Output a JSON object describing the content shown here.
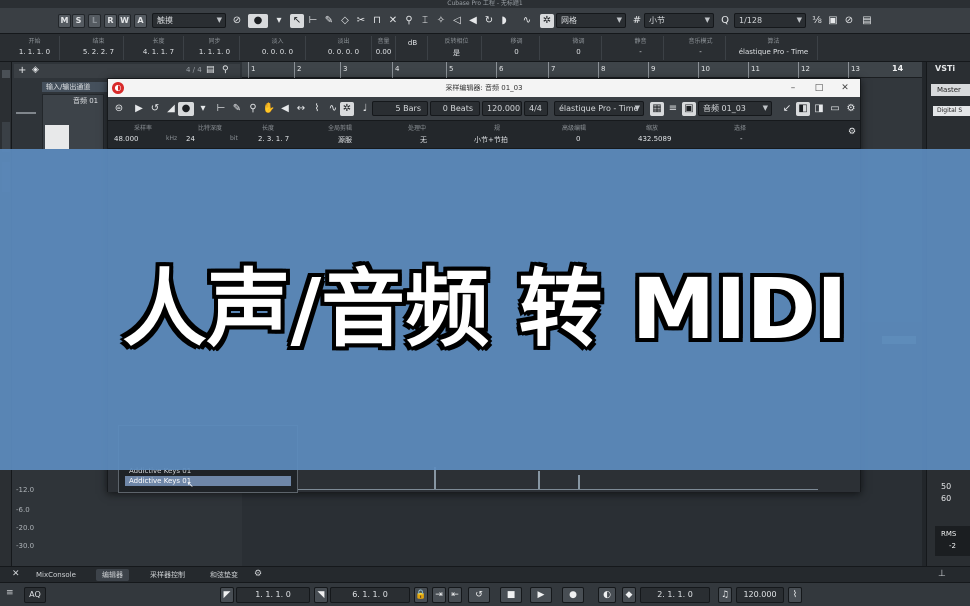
{
  "window": {
    "title": "Cubase Pro 工程 - 无标题1"
  },
  "toolbar": {
    "track_buttons": [
      "M",
      "S",
      "L",
      "R",
      "W",
      "A"
    ],
    "mode_select": "触摸",
    "snap_type": "网格",
    "grid_type": "小节",
    "quantize": "1/128"
  },
  "info_line": [
    {
      "label": "开始",
      "value": "1. 1. 1.   0"
    },
    {
      "label": "结束",
      "value": "5. 2. 2. 7"
    },
    {
      "label": "长度",
      "value": "4. 1. 1. 7"
    },
    {
      "label": "同步",
      "value": "1. 1. 1.   0"
    },
    {
      "label": "淡入",
      "value": "0. 0. 0.   0"
    },
    {
      "label": "淡出",
      "value": "0. 0. 0.   0"
    },
    {
      "label": "音量",
      "value": "0.00"
    },
    {
      "label": "",
      "value": "dB"
    },
    {
      "label": "反转相位",
      "value": "是"
    },
    {
      "label": "移调",
      "value": "0"
    },
    {
      "label": "微调",
      "value": "0"
    },
    {
      "label": "静音",
      "value": "-"
    },
    {
      "label": "音乐模式",
      "value": "-"
    },
    {
      "label": "算法",
      "value": "élastique Pro - Time"
    }
  ],
  "ruler": {
    "marks": [
      "1",
      "2",
      "3",
      "4",
      "5",
      "6",
      "7",
      "8",
      "9",
      "10",
      "11",
      "12",
      "13"
    ],
    "zoom_label": "14",
    "page": "4 / 4"
  },
  "tracklist": {
    "header": "输入/输出通道",
    "track": "音频 01"
  },
  "vsti": {
    "title": "VSTi",
    "master": "Master",
    "digital": "Digital S"
  },
  "editor": {
    "title": "采样编辑器: 音频 01_03",
    "toolbar": {
      "bars": "5 Bars",
      "beats": "0 Beats",
      "tempo": "120.000",
      "signature": "4/4",
      "algorithm": "élastique Pro - Time",
      "event": "音频 01_03"
    },
    "info": [
      {
        "label": "采样率",
        "value": "48.000",
        "unit": "kHz"
      },
      {
        "label": "比特深度",
        "value": "24",
        "unit": "bit"
      },
      {
        "label": "长度",
        "value": "2. 3. 1. 7",
        "unit": ""
      },
      {
        "label": "全局剪辑",
        "value": "源服",
        "unit": ""
      },
      {
        "label": "处理中",
        "value": "无",
        "unit": ""
      },
      {
        "label": "规",
        "value": "小节+节拍",
        "unit": ""
      },
      {
        "label": "高级编辑",
        "value": "0",
        "unit": ""
      },
      {
        "label": "缩放",
        "value": "432.5089",
        "unit": ""
      },
      {
        "label": "选择",
        "value": "-",
        "unit": ""
      }
    ],
    "zone_rows": [
      "Addictive Keys 01",
      "Addictive Keys 01"
    ]
  },
  "meter_scale": [
    "-12.0",
    "-6.0",
    "-20.0",
    "-30.0"
  ],
  "right_scale": [
    "50",
    "60"
  ],
  "rms": {
    "label": "RMS",
    "value": "-2"
  },
  "bottom_tabs": [
    "MixConsole",
    "编辑器",
    "采样器控制",
    "和弦垫变"
  ],
  "transport": {
    "aq": "AQ",
    "left_locator": "1. 1. 1.   0",
    "right_locator": "6. 1. 1.   0",
    "position": "2. 1. 1.   0",
    "tempo": "120.000"
  },
  "banner": {
    "text": "人声/音频 转 MIDI"
  },
  "colors": {
    "banner": "#5c8cbe",
    "accent_red": "#d82a2a",
    "selected": "#6f87a8"
  }
}
